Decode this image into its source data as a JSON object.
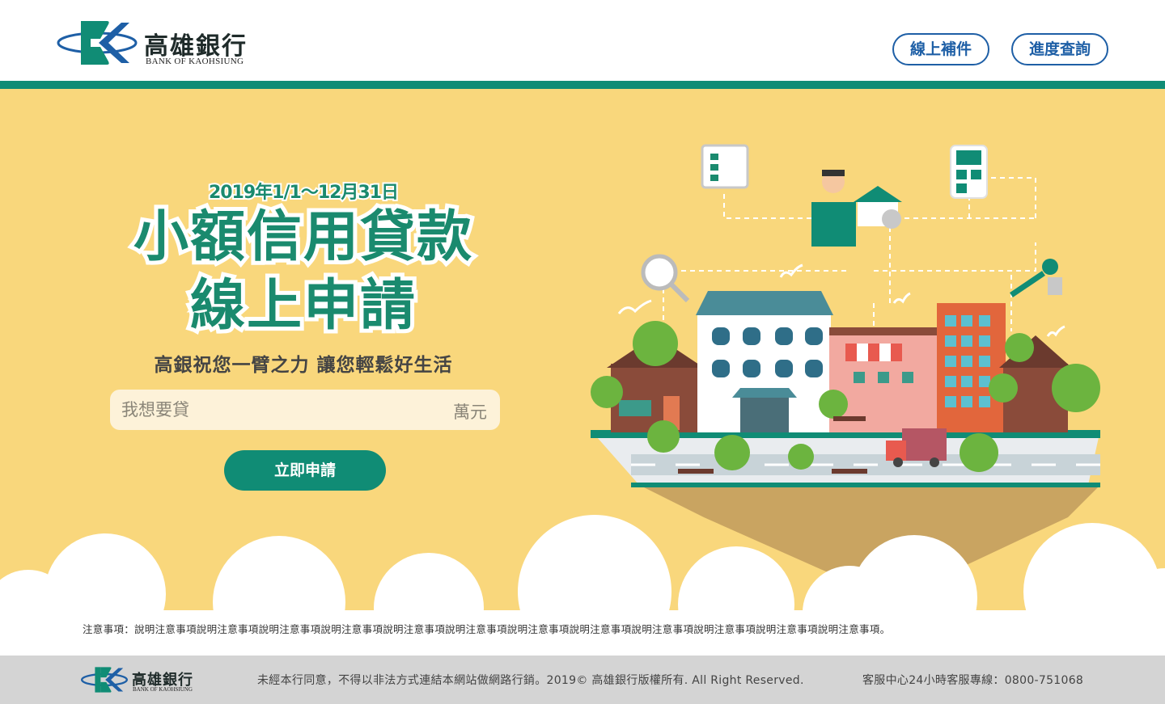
{
  "header": {
    "bank_name": "高雄銀行",
    "bank_name_en": "BANK OF KAOHSIUNG",
    "supplement_button": "線上補件",
    "progress_button": "進度查詢"
  },
  "hero": {
    "date_range": "2019年1/1～12月31日",
    "title_line1": "小額信用貸款",
    "title_line2": "線上申請",
    "slogan": "高銀祝您一臂之力 讓您輕鬆好生活",
    "amount_placeholder": "我想要貸",
    "amount_unit": "萬元",
    "apply_button": "立即申請"
  },
  "notes": "注意事項：說明注意事項說明注意事項說明注意事項說明注意事項說明注意事項說明注意事項說明注意事項說明注意事項說明注意事項說明注意事項說明注意事項說明注意事項。",
  "footer": {
    "bank_name": "高雄銀行",
    "bank_name_en": "BANK OF KAOHSIUNG",
    "copyright": "未經本行同意，不得以非法方式連結本網站做網路行銷。2019© 高雄銀行版權所有. All Right Reserved.",
    "service_line": "客服中心24小時客服專線：0800-751068"
  },
  "colors": {
    "brand_green": "#108c75",
    "hero_yellow": "#f9d77c",
    "button_blue": "#1e5fa6",
    "footer_gray": "#d4d4d4"
  }
}
